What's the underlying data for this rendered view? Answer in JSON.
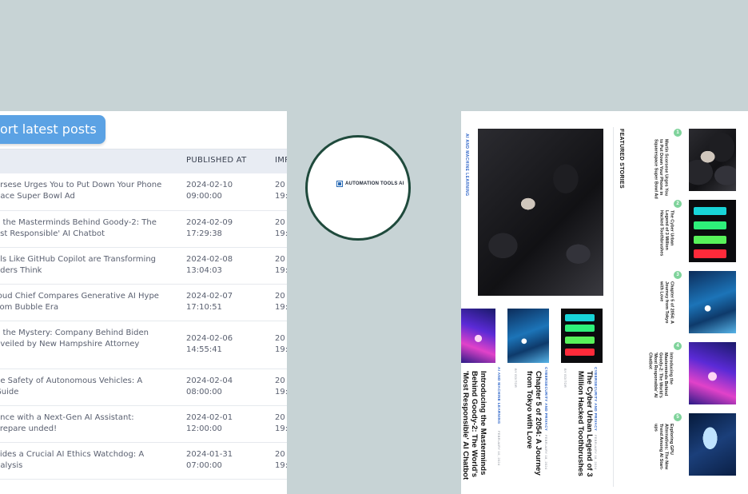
{
  "left": {
    "export_label": "ort latest posts",
    "columns": [
      "PUBLISHED AT",
      "IMP"
    ],
    "rows": [
      {
        "title": "orsese Urges You to Put Down Your Phone pace Super Bowl Ad",
        "published": "2024-02-10 09:00:00",
        "imp": "20 19:"
      },
      {
        "title": "g the Masterminds Behind Goody-2: The ost Responsible' AI Chatbot",
        "published": "2024-02-09 17:29:38",
        "imp": "20 19:"
      },
      {
        "title": "ols Like GitHub Copilot are Transforming oders Think",
        "published": "2024-02-08 13:04:03",
        "imp": "20 19:"
      },
      {
        "title": "loud Chief Compares Generative AI Hype com Bubble Era",
        "published": "2024-02-07 17:10:51",
        "imp": "20 19:"
      },
      {
        "title": "g the Mystery: Company Behind Biden nveiled by New Hampshire Attorney",
        "published": "2024-02-06 14:55:41",
        "imp": "20 19:"
      },
      {
        "title": "he Safety of Autonomous Vehicles: A Guide",
        "published": "2024-02-04 08:00:00",
        "imp": "20 19:"
      },
      {
        "title": "ence with a Next-Gen AI Assistant: Prepare unded!",
        "published": "2024-02-01 12:00:00",
        "imp": "20 19:"
      },
      {
        "title": "vides a Crucial AI Ethics Watchdog: A nalysis",
        "published": "2024-01-31 07:00:00",
        "imp": "20 19:"
      }
    ]
  },
  "logo": {
    "text": "AUTOMATION TOOLS AI",
    "icon": "robot-square-icon"
  },
  "right": {
    "main_category": "AI AND MACHINE LEARNING",
    "featured_heading": "FEATURED STORIES",
    "story_cards": [
      {
        "category": "CYBERSECURITY AND PRIVACY",
        "date": "FEBRUARY 18, 2024",
        "title": "The Cyber Urban Legend of 3 Million Hacked Toothbrushes",
        "author": "BY EDITOR"
      },
      {
        "category": "CYBERSECURITY AND PRIVACY",
        "date": "FEBRUARY 18, 2024",
        "title": "Chapter 5 of 2054: A Journey from Tokyo with Love",
        "author": "BY EDITOR"
      },
      {
        "category": "AI AND MACHINE LEARNING",
        "date": "FEBRUARY 10, 2024",
        "title": "Introducing the Masterminds Behind Goody-2: The World's 'Most Responsible' AI Chatbot",
        "author": "BY EDITOR"
      }
    ],
    "featured": [
      {
        "num": "1",
        "title": "Martin Scorsese Urges You to Put Down Your Phone in Squarespace Super Bowl Ad"
      },
      {
        "num": "2",
        "title": "The Cyber Urban Legend of 3 Million Hacked Toothbrushes"
      },
      {
        "num": "3",
        "title": "Chapter 5 of 2054: A Journey from Tokyo with Love"
      },
      {
        "num": "4",
        "title": "Introducing the Masterminds Behind Goody-2: The World's 'Most Responsible' AI Chatbot"
      },
      {
        "num": "5",
        "title": "Exploring GPU Alternatives: The New Trend Among AI Start-ups"
      }
    ]
  },
  "colors": {
    "background": "#c7d3d5",
    "accent": "#5ba2e4",
    "circle_border": "#1f4a3c",
    "badge": "#7fd39b",
    "category": "#2f66c9"
  }
}
